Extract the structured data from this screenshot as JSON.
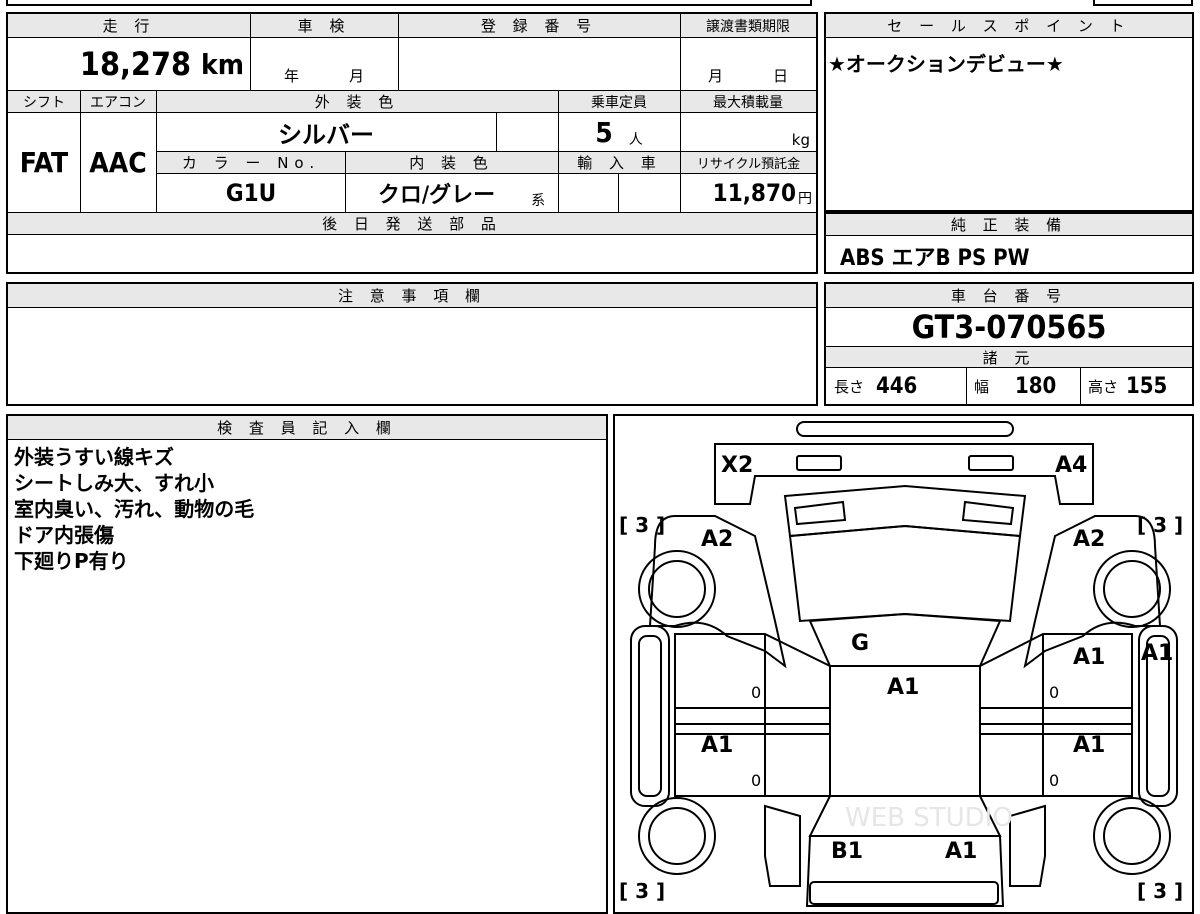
{
  "header": {
    "mileage_label": "走 行",
    "inspection_label": "車 検",
    "registration_label": "登 録 番 号",
    "transfer_doc_label": "譲渡書類期限",
    "mileage_value": "18,278",
    "mileage_unit": "km",
    "inspection_year": "年",
    "inspection_month": "月",
    "transfer_month": "月",
    "transfer_day": "日"
  },
  "specs": {
    "shift_label": "シフト",
    "aircon_label": "エアコン",
    "exterior_label": "外 装 色",
    "capacity_label": "乗車定員",
    "maxload_label": "最大積載量",
    "shift_value": "FAT",
    "aircon_value": "AAC",
    "exterior_value": "シルバー",
    "capacity_value": "5",
    "capacity_unit": "人",
    "maxload_unit": "kg",
    "colorno_label": "カ ラ ー No.",
    "interior_label": "内 装 色",
    "import_label": "輸 入 車",
    "recycle_label": "リサイクル預託金",
    "colorno_value": "G1U",
    "interior_value": "クロ/グレー",
    "interior_suffix": "系",
    "recycle_value": "11,870",
    "recycle_unit": "円",
    "later_parts_label": "後 日 発 送 部 品"
  },
  "sales_point": {
    "label": "セ ー ル ス ポ イ ン ト",
    "text": "★オークションデビュー★"
  },
  "equipment": {
    "label": "純 正 装 備",
    "text": "ABS エアB PS PW"
  },
  "notes": {
    "label": "注 意 事 項 欄"
  },
  "chassis": {
    "label": "車 台 番 号",
    "value": "GT3-070565",
    "dimensions_label": "諸 元",
    "length_label": "長さ",
    "length_value": "446",
    "width_label": "幅",
    "width_value": "180",
    "height_label": "高さ",
    "height_value": "155"
  },
  "inspector": {
    "label": "検 査 員 記 入 欄",
    "lines": [
      "外装うすい線キズ",
      "シートしみ大、すれ小",
      "室内臭い、汚れ、動物の毛",
      "ドア内張傷",
      "下廻りP有り"
    ]
  },
  "diagram": {
    "marks": {
      "x2": "X2",
      "a4": "A4",
      "a2_left": "A2",
      "a2_right": "A2",
      "g": "G",
      "a1_roof": "A1",
      "a1_front_right_door": "A1",
      "a1_right_fender": "A1",
      "a1_rear_left_door": "A1",
      "a1_rear_right_door": "A1",
      "b1": "B1",
      "a1_trunk": "A1",
      "zero_1": "0",
      "zero_2": "0",
      "zero_3": "0",
      "zero_4": "0"
    },
    "tires": {
      "front_left": "[ 3 ]",
      "front_right": "[ 3 ]",
      "rear_left": "[ 3 ]",
      "rear_right": "[ 3 ]"
    },
    "watermark": "WEB STUDIO"
  }
}
